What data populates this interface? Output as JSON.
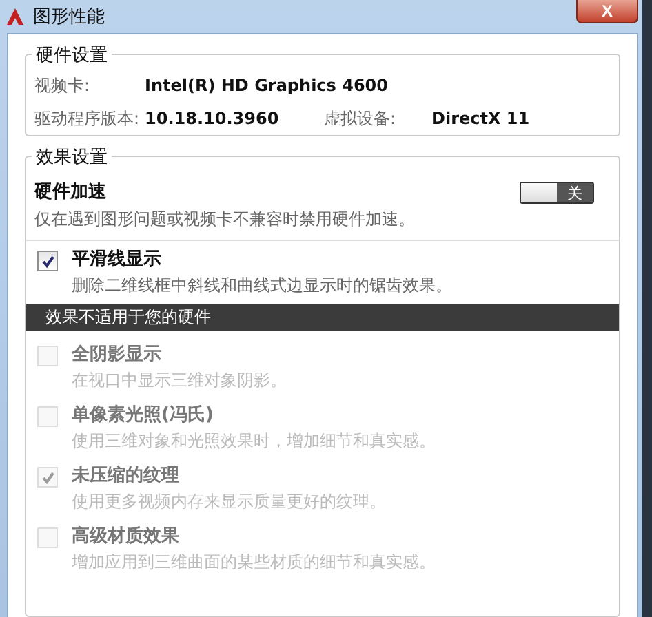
{
  "window": {
    "title": "图形性能",
    "close_label": "X"
  },
  "hardware_settings": {
    "title": "硬件设置",
    "fields": [
      {
        "label": "视频卡:",
        "value": "Intel(R) HD Graphics 4600"
      },
      {
        "label": "驱动程序版本:",
        "value": "10.18.10.3960",
        "label_2": "虚拟设备:",
        "value_2": "DirectX 11"
      }
    ]
  },
  "effect_settings": {
    "title": "效果设置",
    "hardware_acceleration": {
      "title": "硬件加速",
      "description": "仅在遇到图形问题或视频卡不兼容时禁用硬件加速。",
      "on": false,
      "switch_label": "关"
    },
    "items": [
      {
        "kind": "checkbox",
        "title": "平滑线显示",
        "description": "删除二维线框中斜线和曲线式边显示时的锯齿效果。",
        "checked": true,
        "disabled": false
      },
      {
        "kind": "header",
        "title": "效果不适用于您的硬件"
      },
      {
        "kind": "checkbox",
        "title": "全阴影显示",
        "description": "在视口中显示三维对象阴影。",
        "checked": false,
        "disabled": true
      },
      {
        "kind": "checkbox",
        "title": "单像素光照(冯氏)",
        "description": "使用三维对象和光照效果时，增加细节和真实感。",
        "checked": false,
        "disabled": true
      },
      {
        "kind": "checkbox",
        "title": "未压缩的纹理",
        "description": "使用更多视频内存来显示质量更好的纹理。",
        "checked": true,
        "disabled": true
      },
      {
        "kind": "checkbox",
        "title": "高级材质效果",
        "description": "增加应用到三维曲面的某些材质的细节和真实感。",
        "checked": false,
        "disabled": true
      }
    ]
  }
}
